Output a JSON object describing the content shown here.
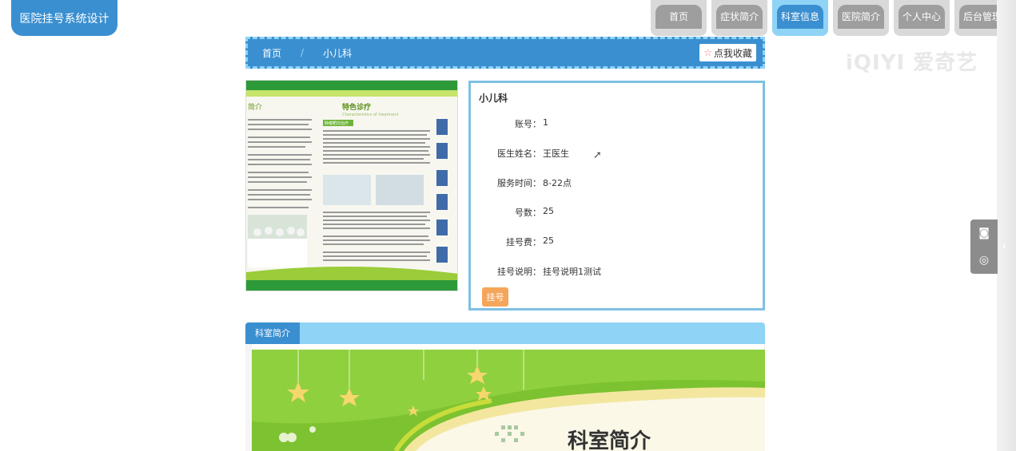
{
  "app": {
    "title": "医院挂号系统设计"
  },
  "nav": [
    {
      "label": "首页",
      "active": false
    },
    {
      "label": "症状简介",
      "active": false
    },
    {
      "label": "科室信息",
      "active": true
    },
    {
      "label": "医院简介",
      "active": false
    },
    {
      "label": "个人中心",
      "active": false
    },
    {
      "label": "后台管理",
      "active": false
    }
  ],
  "breadcrumb": {
    "home": "首页",
    "separator": "/",
    "current": "小儿科",
    "favorite": "点我收藏"
  },
  "watermark": "iQIYI 爱奇艺",
  "detail": {
    "title": "小儿科",
    "fields": [
      {
        "label": "账号：",
        "value": "1"
      },
      {
        "label": "医生姓名：",
        "value": "王医生"
      },
      {
        "label": "服务时间：",
        "value": "8-22点"
      },
      {
        "label": "号数：",
        "value": "25"
      },
      {
        "label": "挂号费：",
        "value": "25"
      },
      {
        "label": "挂号说明：",
        "value": "挂号说明1测试"
      }
    ],
    "book_button": "挂号"
  },
  "intro": {
    "tab": "科室简介",
    "banner_title": "科室简介"
  },
  "photo": {
    "heading": "特色诊疗",
    "sub": "Characteristics of treatment",
    "section": "肿瘤靶向治疗",
    "left_heading": "简介"
  },
  "colors": {
    "primary": "#3a8fd0",
    "light": "#8fd3f6",
    "accent": "#f5a65b",
    "green": "#7cc231"
  }
}
